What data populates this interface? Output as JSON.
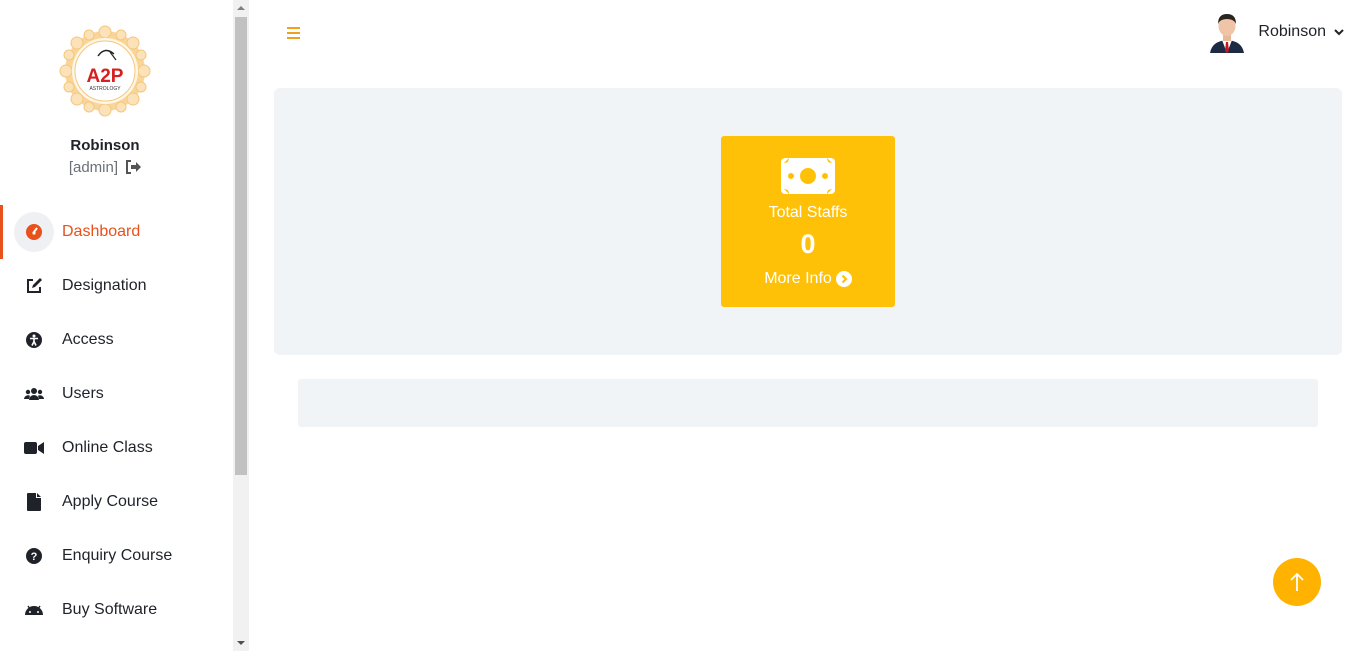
{
  "brand": {
    "logo_text": "A2P",
    "logo_subtext": "ASTROLOGY"
  },
  "profile": {
    "name": "Robinson",
    "role": "[admin]"
  },
  "nav": {
    "items": [
      {
        "label": "Dashboard",
        "icon": "dashboard-gauge-icon",
        "active": true
      },
      {
        "label": "Designation",
        "icon": "edit-icon"
      },
      {
        "label": "Access",
        "icon": "universal-access-icon"
      },
      {
        "label": "Users",
        "icon": "users-icon"
      },
      {
        "label": "Online Class",
        "icon": "video-icon"
      },
      {
        "label": "Apply Course",
        "icon": "file-icon"
      },
      {
        "label": "Enquiry Course",
        "icon": "question-circle-icon"
      },
      {
        "label": "Buy Software",
        "icon": "android-icon"
      }
    ]
  },
  "header": {
    "user_name": "Robinson"
  },
  "stats": {
    "card_label": "Total Staffs",
    "card_value": "0",
    "card_link": "More Info",
    "card_icon": "money-bill-icon"
  },
  "colors": {
    "accent": "#e8501c",
    "card": "#ffc107",
    "back_to_top": "#ffb300",
    "menu_toggle": "#f0a020",
    "panel_bg": "#f1f4f7"
  }
}
